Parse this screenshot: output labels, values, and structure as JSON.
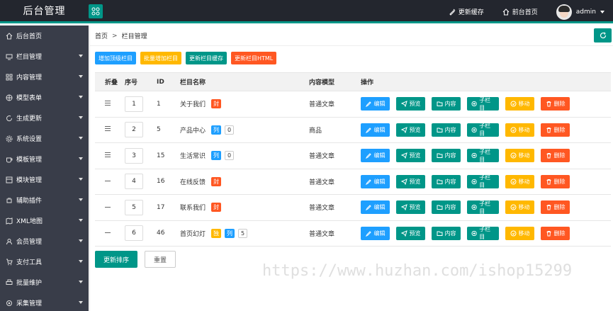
{
  "brand": {
    "title": "后台管理"
  },
  "topbar": {
    "update_cache": "更新缓存",
    "front_home": "前台首页",
    "user": "admin"
  },
  "sidebar": {
    "items": [
      {
        "label": "后台首页",
        "icon": "home-icon",
        "has_arrow": false
      },
      {
        "label": "栏目管理",
        "icon": "monitor-icon",
        "has_arrow": true
      },
      {
        "label": "内容管理",
        "icon": "grid-icon",
        "has_arrow": true
      },
      {
        "label": "模型表单",
        "icon": "globe-icon",
        "has_arrow": true
      },
      {
        "label": "生成更新",
        "icon": "refresh-icon",
        "has_arrow": true
      },
      {
        "label": "系统设置",
        "icon": "gear-icon",
        "has_arrow": true
      },
      {
        "label": "模板管理",
        "icon": "cup-icon",
        "has_arrow": true
      },
      {
        "label": "模块管理",
        "icon": "module-icon",
        "has_arrow": true
      },
      {
        "label": "辅助插件",
        "icon": "plugin-icon",
        "has_arrow": true
      },
      {
        "label": "XML地图",
        "icon": "map-icon",
        "has_arrow": true
      },
      {
        "label": "会员管理",
        "icon": "user-icon",
        "has_arrow": true
      },
      {
        "label": "支付工具",
        "icon": "cart-icon",
        "has_arrow": true
      },
      {
        "label": "批量维护",
        "icon": "print-icon",
        "has_arrow": true
      },
      {
        "label": "采集管理",
        "icon": "collect-icon",
        "has_arrow": true
      }
    ]
  },
  "breadcrumb": {
    "home": "首页",
    "sep": ">",
    "current": "栏目管理"
  },
  "actions": [
    {
      "label": "增加顶级栏目",
      "color": "#1e9fff"
    },
    {
      "label": "批量增加栏目",
      "color": "#ffb800"
    },
    {
      "label": "更新栏目缓存",
      "color": "#009688"
    },
    {
      "label": "更新栏目HTML",
      "color": "#ff5722"
    }
  ],
  "table": {
    "headers": [
      "折叠",
      "序号",
      "ID",
      "栏目名称",
      "内容模型",
      "操作"
    ],
    "rows": [
      {
        "fold": "expand",
        "sort": "1",
        "id": "1",
        "name": "关于我们",
        "tags": [
          {
            "t": "封",
            "c": "#ff5722"
          }
        ],
        "count": "",
        "model": "普通文章"
      },
      {
        "fold": "expand",
        "sort": "2",
        "id": "5",
        "name": "产品中心",
        "tags": [
          {
            "t": "列",
            "c": "#1e9fff"
          }
        ],
        "count": "0",
        "model": "商品"
      },
      {
        "fold": "expand",
        "sort": "3",
        "id": "15",
        "name": "生活常识",
        "tags": [
          {
            "t": "列",
            "c": "#1e9fff"
          }
        ],
        "count": "0",
        "model": "普通文章"
      },
      {
        "fold": "collapse",
        "sort": "4",
        "id": "16",
        "name": "在线反馈",
        "tags": [
          {
            "t": "封",
            "c": "#ff5722"
          }
        ],
        "count": "",
        "model": "普通文章"
      },
      {
        "fold": "collapse",
        "sort": "5",
        "id": "17",
        "name": "联系我们",
        "tags": [
          {
            "t": "封",
            "c": "#ff5722"
          }
        ],
        "count": "",
        "model": "普通文章"
      },
      {
        "fold": "collapse",
        "sort": "6",
        "id": "46",
        "name": "首页幻灯",
        "tags": [
          {
            "t": "独",
            "c": "#ffb800"
          },
          {
            "t": "列",
            "c": "#1e9fff"
          }
        ],
        "count": "5",
        "model": "普通文章"
      }
    ],
    "ops": [
      {
        "label": "编辑",
        "color": "#1e9fff",
        "icon": "edit-icon"
      },
      {
        "label": "预览",
        "color": "#009688",
        "icon": "send-icon"
      },
      {
        "label": "内容",
        "color": "#009688",
        "icon": "folder-icon"
      },
      {
        "label": "子栏目",
        "color": "#009688",
        "icon": "plus-circle-icon"
      },
      {
        "label": "移动",
        "color": "#ffb800",
        "icon": "move-icon"
      },
      {
        "label": "删除",
        "color": "#ff5722",
        "icon": "trash-icon"
      }
    ]
  },
  "bottom": {
    "save_order": "更新排序",
    "reset": "重置"
  },
  "watermark": "https://www.huzhan.com/ishop15299"
}
